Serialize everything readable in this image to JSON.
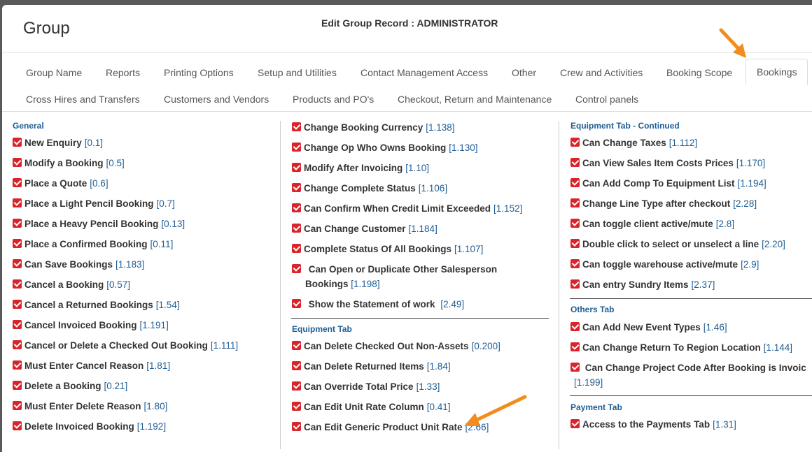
{
  "header": {
    "group_title": "Group",
    "edit_title": "Edit Group Record : ADMINISTRATOR"
  },
  "tabs": [
    {
      "label": "Group Name"
    },
    {
      "label": "Reports"
    },
    {
      "label": "Printing Options"
    },
    {
      "label": "Setup and Utilities"
    },
    {
      "label": "Contact Management Access"
    },
    {
      "label": "Other"
    },
    {
      "label": "Crew and Activities"
    },
    {
      "label": "Booking Scope"
    },
    {
      "label": "Bookings"
    },
    {
      "label": "Cross Hires and Transfers"
    },
    {
      "label": "Customers and Vendors"
    },
    {
      "label": "Products and PO's"
    },
    {
      "label": "Checkout, Return and Maintenance"
    },
    {
      "label": "Control panels"
    }
  ],
  "active_tab": "Bookings",
  "checkbox_color": "#d9242b",
  "accent_color": "#1f5d94",
  "arrow_color": "#f28c1c",
  "col1": {
    "title": "General",
    "items": [
      {
        "label": "New Enquiry",
        "code": "[0.1]"
      },
      {
        "label": "Modify a Booking",
        "code": "[0.5]"
      },
      {
        "label": "Place a Quote",
        "code": "[0.6]"
      },
      {
        "label": "Place a Light Pencil Booking",
        "code": "[0.7]"
      },
      {
        "label": "Place a Heavy Pencil Booking",
        "code": "[0.13]"
      },
      {
        "label": "Place a Confirmed Booking",
        "code": "[0.11]"
      },
      {
        "label": "Can Save Bookings",
        "code": "[1.183]"
      },
      {
        "label": "Cancel a Booking",
        "code": "[0.57]"
      },
      {
        "label": "Cancel a Returned Bookings",
        "code": "[1.54]"
      },
      {
        "label": "Cancel Invoiced Booking",
        "code": "[1.191]"
      },
      {
        "label": "Cancel or Delete a Checked Out Booking",
        "code": "[1.111]"
      },
      {
        "label": "Must Enter Cancel Reason",
        "code": "[1.81]"
      },
      {
        "label": "Delete a Booking",
        "code": "[0.21]"
      },
      {
        "label": "Must Enter Delete Reason",
        "code": "[1.80]"
      },
      {
        "label": "Delete Invoiced Booking",
        "code": "[1.192]"
      }
    ]
  },
  "col2": {
    "items_top": [
      {
        "label": "Change Booking Currency",
        "code": "[1.138]"
      },
      {
        "label": "Change Op Who Owns Booking",
        "code": "[1.130]"
      },
      {
        "label": "Modify After Invoicing",
        "code": "[1.10]"
      },
      {
        "label": "Change Complete Status",
        "code": "[1.106]"
      },
      {
        "label": "Can Confirm When Credit Limit Exceeded",
        "code": "[1.152]"
      },
      {
        "label": "Can Change Customer",
        "code": "[1.184]"
      },
      {
        "label": "Complete Status Of All Bookings",
        "code": "[1.107]"
      }
    ],
    "open_dup": {
      "line1": "Can Open or Duplicate Other Salesperson",
      "line2": "Bookings",
      "code": "[1.198]"
    },
    "statement": {
      "label": "Show the Statement of work",
      "code": "[2.49]"
    },
    "equipment_title": "Equipment Tab",
    "equipment_items": [
      {
        "label": "Can Delete Checked Out Non-Assets",
        "code": "[0.200]"
      },
      {
        "label": "Can Delete Returned Items",
        "code": "[1.84]"
      },
      {
        "label": "Can Override Total Price",
        "code": "[1.33]"
      },
      {
        "label": "Can Edit Unit Rate Column",
        "code": "[0.41]"
      },
      {
        "label": "Can Edit Generic Product Unit Rate",
        "code": "[2.66]"
      }
    ]
  },
  "col3": {
    "title": "Equipment Tab - Continued",
    "items": [
      {
        "label": "Can Change Taxes",
        "code": "[1.112]"
      },
      {
        "label": "Can View Sales Item Costs Prices",
        "code": "[1.170]"
      },
      {
        "label": "Can Add Comp To Equipment List",
        "code": "[1.194]"
      },
      {
        "label": "Change Line Type after checkout",
        "code": "[2.28]"
      },
      {
        "label": "Can toggle client active/mute",
        "code": "[2.8]"
      },
      {
        "label": "Double click to select or unselect a line",
        "code": "[2.20]"
      },
      {
        "label": "Can toggle warehouse active/mute",
        "code": "[2.9]"
      },
      {
        "label": "Can entry Sundry Items",
        "code": "[2.37]"
      }
    ],
    "others_title": "Others Tab",
    "others_items": [
      {
        "label": "Can Add New Event Types",
        "code": "[1.46]"
      },
      {
        "label": "Can Change Return To Region Location",
        "code": "[1.144]"
      }
    ],
    "project_code": {
      "line1": "Can Change Project Code After Booking is Invoic",
      "code": "[1.199]"
    },
    "payment_title": "Payment Tab",
    "payment_items": [
      {
        "label": "Access to the Payments Tab",
        "code": "[1.31]"
      }
    ]
  }
}
